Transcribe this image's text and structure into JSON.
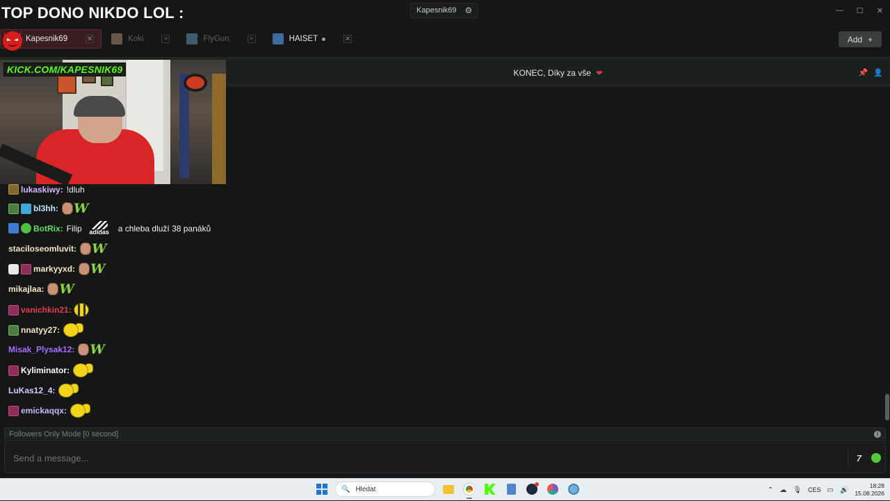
{
  "overlay_title": "TOP DONO NIKDO LOL :",
  "window": {
    "title": "Kapesnik69",
    "gear_icon": "gear-icon",
    "controls": {
      "minimize": "—",
      "maximize": "☐",
      "close": "✕"
    }
  },
  "tabs": [
    {
      "label": "Kapesnik69",
      "active": true
    },
    {
      "label": "Koki",
      "active": false
    },
    {
      "label": "FlyGun",
      "active": false
    },
    {
      "label": "HAISET",
      "active": false,
      "live": true
    }
  ],
  "add_button": {
    "label": "Add",
    "icon": "+"
  },
  "pinned": {
    "text": "KONEC, Díky za vše",
    "heart": "❤"
  },
  "video": {
    "banner": "KICK.COM/KAPESNIK69"
  },
  "chat": {
    "colors": {
      "lukaskiwy": "#d4b7ff",
      "bl3hh": "#b8e4ff",
      "BotRix": "#5ede63",
      "staciloseomluvit": "#f3e5c8",
      "markyyxd": "#f3e5c8",
      "mikajlaa": "#f3e5c8",
      "vanichkin21": "#e23b52",
      "nnatyy27": "#f3e5c8",
      "Misak_Plysak12": "#a86bff",
      "Kyliminator": "#ffffff",
      "LuKas12_4": "#d9c7ff",
      "emickaqqx": "#c2b7ff"
    },
    "messages": [
      {
        "user": "lukaskiwy",
        "text": "!dluh"
      },
      {
        "user": "bl3hh",
        "text": ""
      },
      {
        "user": "BotRix",
        "text_before": "Filip",
        "adidas_word": "adidas",
        "text_after": "a chleba dluží 38 panáků"
      },
      {
        "user": "staciloseomluvit",
        "text": ""
      },
      {
        "user": "markyyxd",
        "text": ""
      },
      {
        "user": "mikajlaa",
        "text": ""
      },
      {
        "user": "vanichkin21",
        "text": ""
      },
      {
        "user": "nnatyy27",
        "text": ""
      },
      {
        "user": "Misak_Plysak12",
        "text": ""
      },
      {
        "user": "Kyliminator",
        "text": ""
      },
      {
        "user": "LuKas12_4",
        "text": ""
      },
      {
        "user": "emickaqqx",
        "text": ""
      }
    ],
    "emote_w": "W"
  },
  "followers_mode": "Followers Only Mode [0 second]",
  "input": {
    "placeholder": "Send a message..."
  },
  "input_tools": {
    "seventv": "7"
  },
  "taskbar": {
    "search_placeholder": "Hledat",
    "lang": "CES",
    "time": "18:28",
    "date": "15.08.2026"
  }
}
